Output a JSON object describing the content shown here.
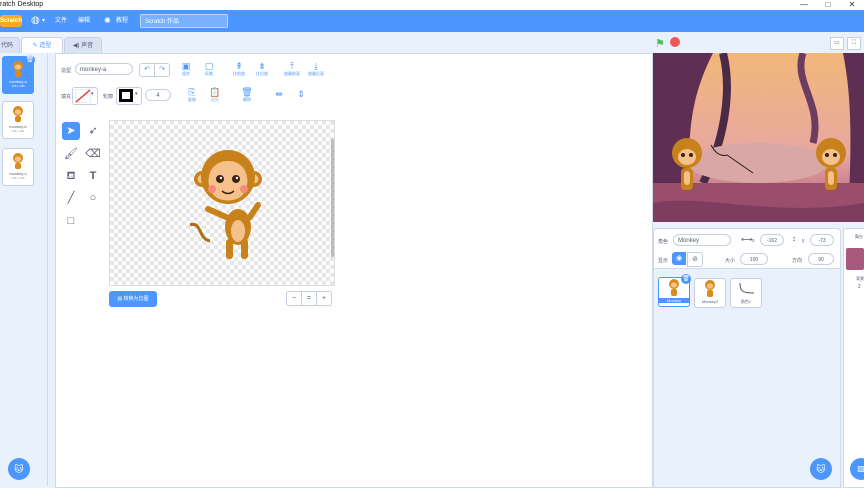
{
  "window": {
    "title": "ratch Desktop",
    "min": "—",
    "max": "□"
  },
  "menubar": {
    "logo": "Scratch",
    "globe_caret": "▾",
    "file": "文件",
    "edit": "编辑",
    "tutorials": "教程",
    "project_name": "Scratch 作品"
  },
  "tabs": {
    "code": "代码",
    "costumes": "造型",
    "sounds": "声音"
  },
  "costumes": [
    {
      "name": "monkey-a",
      "size": "126 x 136"
    },
    {
      "name": "monkey-b",
      "size": "125 x 131"
    },
    {
      "name": "monkey-c",
      "size": "123 x 136"
    }
  ],
  "editor": {
    "costume_label": "造型",
    "costume_name": "monkey-a",
    "fill_label": "填充",
    "outline_label": "轮廓",
    "outline_width": "4",
    "group": "组合",
    "ungroup": "拆散",
    "forward": "往前放",
    "backward": "往后放",
    "front": "放最前面",
    "back": "放最后面",
    "copy": "复制",
    "paste": "粘贴",
    "delete": "删除",
    "convert": "转换为位图",
    "zoom_out": "−",
    "zoom_reset": "=",
    "zoom_in": "+"
  },
  "sprite_info": {
    "sprite_label": "角色",
    "sprite_name": "Monkey",
    "x_label": "x",
    "x_value": "-162",
    "y_label": "y",
    "y_value": "-73",
    "show_label": "显示",
    "size_label": "大小",
    "size_value": "100",
    "direction_label": "方向",
    "direction_value": "90"
  },
  "sprites": [
    {
      "name": "Monkey"
    },
    {
      "name": "Monkey2"
    },
    {
      "name": "角色1"
    }
  ],
  "stage_pane": {
    "title": "舞台",
    "backdrops_label": "背景",
    "backdrops_count": "2"
  },
  "colors": {
    "accent": "#4c97ff",
    "fill": "#ffffff",
    "outline": "#000000"
  }
}
